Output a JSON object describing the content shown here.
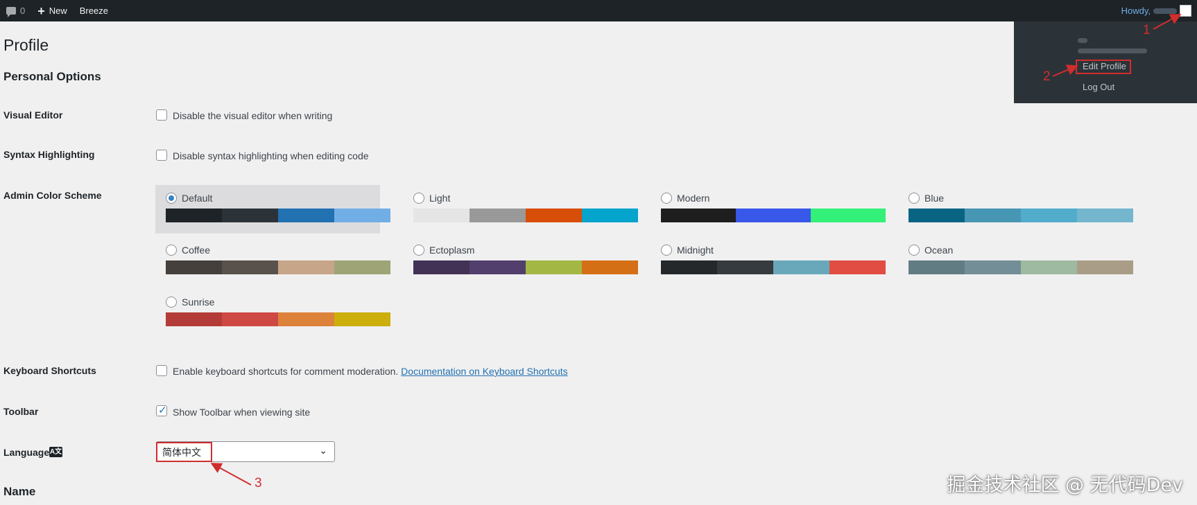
{
  "adminbar": {
    "comments_count": "0",
    "new_label": "New",
    "breeze_label": "Breeze",
    "howdy_label": "Howdy,"
  },
  "user_menu": {
    "edit_profile": "Edit Profile",
    "log_out": "Log Out"
  },
  "page": {
    "title": "Profile",
    "personal_options_heading": "Personal Options",
    "name_heading": "Name"
  },
  "visual_editor": {
    "label": "Visual Editor",
    "checkbox_label": "Disable the visual editor when writing",
    "checked": false
  },
  "syntax_highlighting": {
    "label": "Syntax Highlighting",
    "checkbox_label": "Disable syntax highlighting when editing code",
    "checked": false
  },
  "color_scheme": {
    "label": "Admin Color Scheme",
    "selected": "Default",
    "schemes": [
      {
        "name": "Default",
        "colors": [
          "#1d2327",
          "#2c3338",
          "#2271b1",
          "#72aee6"
        ]
      },
      {
        "name": "Light",
        "colors": [
          "#e5e5e5",
          "#999999",
          "#d64e07",
          "#04a4cc"
        ]
      },
      {
        "name": "Modern",
        "colors": [
          "#1e1e1e",
          "#3858e9",
          "#33f078"
        ]
      },
      {
        "name": "Blue",
        "colors": [
          "#096484",
          "#4796b3",
          "#52accc",
          "#74b6ce"
        ]
      },
      {
        "name": "Coffee",
        "colors": [
          "#46403c",
          "#59524c",
          "#c7a589",
          "#9ea476"
        ]
      },
      {
        "name": "Ectoplasm",
        "colors": [
          "#413256",
          "#523f6d",
          "#a3b745",
          "#d46f15"
        ]
      },
      {
        "name": "Midnight",
        "colors": [
          "#25282b",
          "#363b3f",
          "#69a8bb",
          "#e14d43"
        ]
      },
      {
        "name": "Ocean",
        "colors": [
          "#627c83",
          "#738e96",
          "#9ebaa0",
          "#aa9d88"
        ]
      },
      {
        "name": "Sunrise",
        "colors": [
          "#b43c38",
          "#cf4944",
          "#dd823b",
          "#ccaf0b"
        ]
      }
    ]
  },
  "keyboard_shortcuts": {
    "label": "Keyboard Shortcuts",
    "checkbox_label": "Enable keyboard shortcuts for comment moderation.",
    "doc_link": "Documentation on Keyboard Shortcuts",
    "checked": false
  },
  "toolbar": {
    "label": "Toolbar",
    "checkbox_label": "Show Toolbar when viewing site",
    "checked": true
  },
  "language": {
    "label": "Language",
    "selected": "简体中文"
  },
  "annotations": {
    "step1": "1",
    "step2": "2",
    "step3": "3"
  },
  "watermark": "掘金技术社区 @ 无代码Dev"
}
